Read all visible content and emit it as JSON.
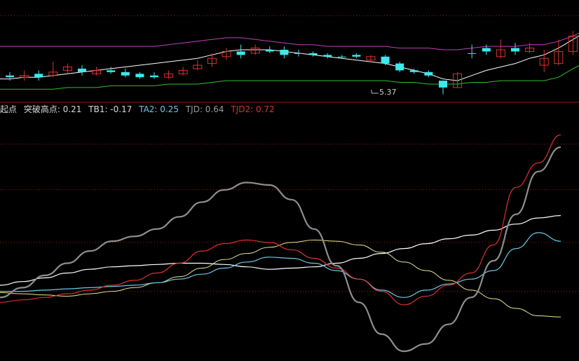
{
  "chart_data": [
    {
      "type": "candlestick",
      "annotation": "5.37",
      "colors": {
        "up": "#e03030",
        "down": "#3ee8ec",
        "pink_band": "#c040c0",
        "white_band": "#ffffff",
        "green_band": "#30c030",
        "background": "#000000",
        "separator": "#a01818"
      },
      "candles": [
        {
          "o": 5.34,
          "c": 5.33,
          "h": 5.36,
          "l": 5.31,
          "up": false
        },
        {
          "o": 5.33,
          "c": 5.34,
          "h": 5.37,
          "l": 5.31,
          "up": true
        },
        {
          "o": 5.35,
          "c": 5.33,
          "h": 5.37,
          "l": 5.31,
          "up": false
        },
        {
          "o": 5.34,
          "c": 5.36,
          "h": 5.42,
          "l": 5.33,
          "up": true
        },
        {
          "o": 5.37,
          "c": 5.39,
          "h": 5.41,
          "l": 5.35,
          "up": true
        },
        {
          "o": 5.38,
          "c": 5.36,
          "h": 5.4,
          "l": 5.34,
          "up": false
        },
        {
          "o": 5.35,
          "c": 5.37,
          "h": 5.39,
          "l": 5.34,
          "up": true
        },
        {
          "o": 5.37,
          "c": 5.36,
          "h": 5.39,
          "l": 5.35,
          "up": false
        },
        {
          "o": 5.36,
          "c": 5.34,
          "h": 5.38,
          "l": 5.33,
          "up": false
        },
        {
          "o": 5.35,
          "c": 5.33,
          "h": 5.36,
          "l": 5.32,
          "up": false
        },
        {
          "o": 5.34,
          "c": 5.33,
          "h": 5.36,
          "l": 5.32,
          "up": false
        },
        {
          "o": 5.33,
          "c": 5.35,
          "h": 5.37,
          "l": 5.32,
          "up": true
        },
        {
          "o": 5.35,
          "c": 5.37,
          "h": 5.39,
          "l": 5.34,
          "up": true
        },
        {
          "o": 5.38,
          "c": 5.4,
          "h": 5.43,
          "l": 5.37,
          "up": true
        },
        {
          "o": 5.41,
          "c": 5.44,
          "h": 5.47,
          "l": 5.39,
          "up": true
        },
        {
          "o": 5.45,
          "c": 5.48,
          "h": 5.5,
          "l": 5.43,
          "up": true
        },
        {
          "o": 5.48,
          "c": 5.46,
          "h": 5.52,
          "l": 5.44,
          "up": false
        },
        {
          "o": 5.47,
          "c": 5.5,
          "h": 5.52,
          "l": 5.46,
          "up": true
        },
        {
          "o": 5.49,
          "c": 5.48,
          "h": 5.51,
          "l": 5.47,
          "up": false
        },
        {
          "o": 5.49,
          "c": 5.46,
          "h": 5.51,
          "l": 5.44,
          "up": false
        },
        {
          "o": 5.47,
          "c": 5.47,
          "h": 5.49,
          "l": 5.45,
          "up": false
        },
        {
          "o": 5.47,
          "c": 5.46,
          "h": 5.48,
          "l": 5.45,
          "up": false
        },
        {
          "o": 5.46,
          "c": 5.45,
          "h": 5.47,
          "l": 5.44,
          "up": false
        },
        {
          "o": 5.45,
          "c": 5.45,
          "h": 5.46,
          "l": 5.44,
          "up": false
        },
        {
          "o": 5.46,
          "c": 5.45,
          "h": 5.47,
          "l": 5.44,
          "up": false
        },
        {
          "o": 5.43,
          "c": 5.45,
          "h": 5.46,
          "l": 5.42,
          "up": true
        },
        {
          "o": 5.45,
          "c": 5.41,
          "h": 5.46,
          "l": 5.4,
          "up": false
        },
        {
          "o": 5.41,
          "c": 5.37,
          "h": 5.42,
          "l": 5.36,
          "up": false
        },
        {
          "o": 5.37,
          "c": 5.36,
          "h": 5.38,
          "l": 5.35,
          "up": false
        },
        {
          "o": 5.36,
          "c": 5.34,
          "h": 5.37,
          "l": 5.33,
          "up": false
        },
        {
          "o": 5.31,
          "c": 5.27,
          "h": 5.31,
          "l": 5.23,
          "up": false
        },
        {
          "o": 5.27,
          "c": 5.35,
          "h": 5.36,
          "l": 5.27,
          "up": true
        },
        {
          "o": 5.47,
          "c": 5.47,
          "h": 5.52,
          "l": 5.44,
          "up": false
        },
        {
          "o": 5.5,
          "c": 5.48,
          "h": 5.52,
          "l": 5.46,
          "up": false
        },
        {
          "o": 5.45,
          "c": 5.49,
          "h": 5.55,
          "l": 5.44,
          "up": true
        },
        {
          "o": 5.5,
          "c": 5.48,
          "h": 5.53,
          "l": 5.46,
          "up": false
        },
        {
          "o": 5.48,
          "c": 5.5,
          "h": 5.53,
          "l": 5.47,
          "up": true
        },
        {
          "o": 5.4,
          "c": 5.44,
          "h": 5.49,
          "l": 5.36,
          "up": true
        },
        {
          "o": 5.41,
          "c": 5.48,
          "h": 5.55,
          "l": 5.4,
          "up": true
        },
        {
          "o": 5.48,
          "c": 5.57,
          "h": 5.6,
          "l": 5.46,
          "up": true
        },
        {
          "o": 5.58,
          "c": 5.64,
          "h": 5.72,
          "l": 5.56,
          "up": true
        },
        {
          "o": 5.64,
          "c": 5.7,
          "h": 5.74,
          "l": 5.62,
          "up": true
        },
        {
          "o": 5.68,
          "c": 5.68,
          "h": 5.74,
          "l": 5.65,
          "up": false
        },
        {
          "o": 5.72,
          "c": 5.64,
          "h": 5.76,
          "l": 5.62,
          "up": false
        },
        {
          "o": 5.66,
          "c": 5.7,
          "h": 5.74,
          "l": 5.64,
          "up": true
        }
      ],
      "bands": {
        "pink": [
          5.51,
          5.51,
          5.51,
          5.51,
          5.51,
          5.51,
          5.51,
          5.51,
          5.51,
          5.51,
          5.51,
          5.52,
          5.53,
          5.54,
          5.55,
          5.56,
          5.56,
          5.55,
          5.54,
          5.53,
          5.52,
          5.52,
          5.51,
          5.51,
          5.51,
          5.51,
          5.51,
          5.5,
          5.5,
          5.5,
          5.49,
          5.49,
          5.5,
          5.51,
          5.51,
          5.51,
          5.52,
          5.52,
          5.54,
          5.57,
          5.61,
          5.66,
          5.7,
          5.74,
          5.77
        ],
        "white": [
          5.32,
          5.33,
          5.33,
          5.34,
          5.35,
          5.36,
          5.37,
          5.38,
          5.39,
          5.4,
          5.41,
          5.42,
          5.43,
          5.44,
          5.46,
          5.48,
          5.49,
          5.49,
          5.49,
          5.48,
          5.47,
          5.46,
          5.45,
          5.44,
          5.43,
          5.42,
          5.41,
          5.39,
          5.37,
          5.35,
          5.32,
          5.31,
          5.34,
          5.37,
          5.39,
          5.41,
          5.44,
          5.46,
          5.5,
          5.55,
          5.6,
          5.64,
          5.68,
          5.71,
          5.74
        ],
        "green": [
          5.26,
          5.26,
          5.26,
          5.26,
          5.27,
          5.27,
          5.27,
          5.28,
          5.28,
          5.28,
          5.28,
          5.29,
          5.29,
          5.29,
          5.3,
          5.31,
          5.31,
          5.31,
          5.31,
          5.31,
          5.31,
          5.31,
          5.31,
          5.31,
          5.31,
          5.31,
          5.31,
          5.3,
          5.3,
          5.29,
          5.29,
          5.29,
          5.3,
          5.3,
          5.31,
          5.31,
          5.31,
          5.31,
          5.33,
          5.38,
          5.42,
          5.47,
          5.52,
          5.58,
          5.64
        ]
      },
      "ylim": [
        5.2,
        5.78
      ]
    },
    {
      "type": "line",
      "legend": [
        {
          "text": "起点",
          "color": "#d8d8d8"
        },
        {
          "text": "突破高点: 0.21",
          "color": "#d8d8d8"
        },
        {
          "text": "TB1: -0.17",
          "color": "#d8d8d8"
        },
        {
          "text": "TA2: 0.25",
          "color": "#6ec8e8"
        },
        {
          "text": "TJD: 0.64",
          "color": "#9a9a9a"
        },
        {
          "text": "TJD2: 0.72",
          "color": "#e03030"
        }
      ],
      "x": [
        0,
        4,
        8,
        12,
        16,
        20,
        24,
        28,
        32,
        36,
        40,
        44,
        48,
        52,
        56,
        60,
        64,
        68,
        72,
        76,
        80,
        84,
        88,
        92,
        96,
        100
      ],
      "series": [
        {
          "color": "#ffffff",
          "width": 1.2,
          "values": [
            0.12,
            0.15,
            0.18,
            0.22,
            0.25,
            0.27,
            0.28,
            0.29,
            0.3,
            0.3,
            0.29,
            0.27,
            0.25,
            0.26,
            0.27,
            0.3,
            0.34,
            0.38,
            0.42,
            0.46,
            0.5,
            0.53,
            0.57,
            0.62,
            0.67,
            0.69
          ]
        },
        {
          "color": "#e8e890",
          "width": 1.0,
          "values": [
            0.06,
            0.05,
            0.04,
            0.03,
            0.05,
            0.07,
            0.1,
            0.14,
            0.19,
            0.26,
            0.33,
            0.38,
            0.43,
            0.47,
            0.49,
            0.48,
            0.45,
            0.39,
            0.31,
            0.24,
            0.16,
            0.08,
            0.01,
            -0.07,
            -0.13,
            -0.14
          ]
        },
        {
          "color": "#6ec8e8",
          "width": 1.2,
          "values": [
            0.07,
            0.07,
            0.08,
            0.09,
            0.1,
            0.11,
            0.12,
            0.14,
            0.17,
            0.21,
            0.26,
            0.31,
            0.35,
            0.34,
            0.3,
            0.24,
            0.17,
            0.08,
            0.02,
            0.08,
            0.13,
            0.17,
            0.24,
            0.42,
            0.55,
            0.48
          ]
        },
        {
          "color": "#e03030",
          "width": 1.2,
          "values": [
            -0.02,
            0.0,
            0.02,
            0.05,
            0.08,
            0.12,
            0.16,
            0.22,
            0.3,
            0.4,
            0.46,
            0.49,
            0.47,
            0.41,
            0.34,
            0.26,
            0.17,
            0.07,
            -0.04,
            0.03,
            0.12,
            0.22,
            0.45,
            0.92,
            1.12,
            1.35
          ]
        },
        {
          "color": "#8f8f8f",
          "width": 2.2,
          "values": [
            0.02,
            0.1,
            0.2,
            0.3,
            0.4,
            0.48,
            0.52,
            0.58,
            0.68,
            0.8,
            0.9,
            0.96,
            0.94,
            0.82,
            0.58,
            0.28,
            -0.02,
            -0.28,
            -0.42,
            -0.36,
            -0.2,
            0.02,
            0.32,
            0.7,
            1.05,
            1.25
          ]
        }
      ],
      "ylim": [
        -0.5,
        1.45
      ]
    }
  ]
}
